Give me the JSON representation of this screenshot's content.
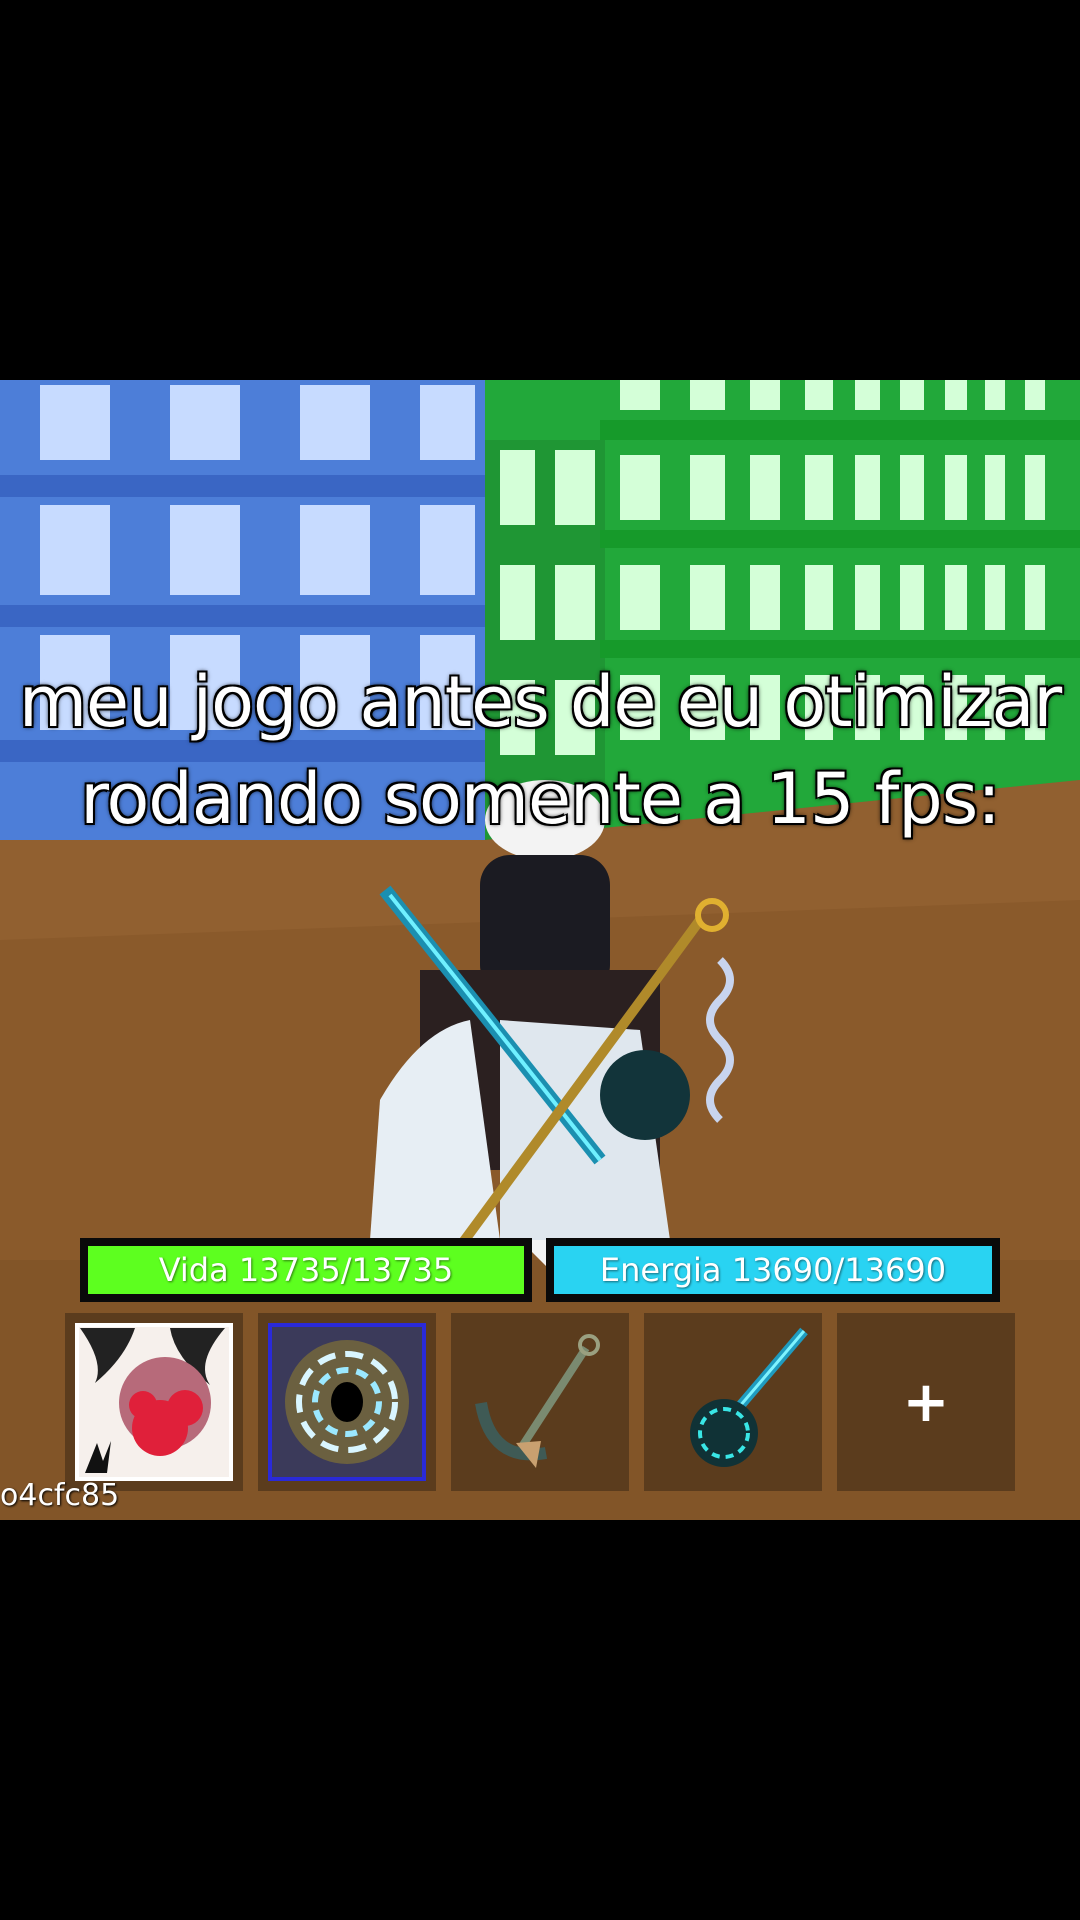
{
  "caption": {
    "line1": "meu jogo antes de eu otimizar",
    "line2": "rodando somente a 15 fps:"
  },
  "hud": {
    "health": {
      "label": "Vida 13735/13735",
      "current": 13735,
      "max": 13735,
      "color": "#5dff1f"
    },
    "energy": {
      "label": "Energia 13690/13690",
      "current": 13690,
      "max": 13690,
      "color": "#29d3f2"
    }
  },
  "hotbar": {
    "slots": [
      {
        "icon": "devil-fruit-icon",
        "selected": false
      },
      {
        "icon": "dark-vortex-icon",
        "selected": true
      },
      {
        "icon": "anchor-weapon-icon",
        "selected": false
      },
      {
        "icon": "guitar-mace-icon",
        "selected": false
      },
      {
        "icon": "plus-icon",
        "label": "+",
        "selected": false
      }
    ]
  },
  "user_id": "o4cfc85"
}
